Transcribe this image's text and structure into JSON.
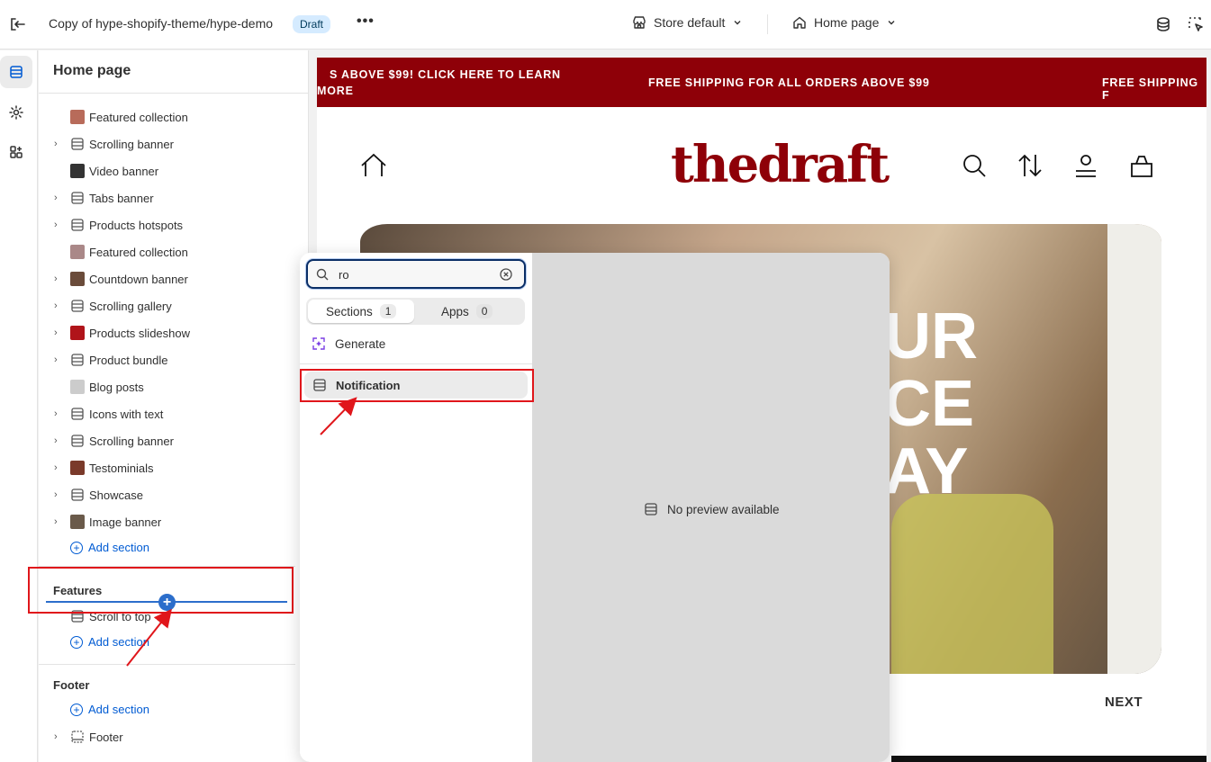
{
  "topbar": {
    "title": "Copy of hype-shopify-theme/hype-demo",
    "badge": "Draft",
    "more": "•••",
    "store": "Store default",
    "page": "Home page"
  },
  "sidebar": {
    "title": "Home page",
    "items": [
      {
        "label": "Featured collection",
        "expandable": false
      },
      {
        "label": "Scrolling banner",
        "expandable": true
      },
      {
        "label": "Video banner",
        "expandable": false
      },
      {
        "label": "Tabs banner",
        "expandable": true
      },
      {
        "label": "Products hotspots",
        "expandable": true
      },
      {
        "label": "Featured collection",
        "expandable": false
      },
      {
        "label": "Countdown banner",
        "expandable": true
      },
      {
        "label": "Scrolling gallery",
        "expandable": true
      },
      {
        "label": "Products slideshow",
        "expandable": true
      },
      {
        "label": "Product bundle",
        "expandable": true
      },
      {
        "label": "Blog posts",
        "expandable": false
      },
      {
        "label": "Icons with text",
        "expandable": true
      },
      {
        "label": "Scrolling banner",
        "expandable": true
      },
      {
        "label": "Testominials",
        "expandable": true
      },
      {
        "label": "Showcase",
        "expandable": true
      },
      {
        "label": "Image banner",
        "expandable": true
      }
    ],
    "add_section": "Add section",
    "features_title": "Features",
    "features_item": "Scroll to top",
    "footer_title": "Footer",
    "footer_item": "Footer"
  },
  "preview": {
    "announce_left_1": "S ABOVE $99! CLICK HERE TO LEARN",
    "announce_left_2": "MORE",
    "announce_mid": "FREE SHIPPING FOR ALL ORDERS ABOVE $99",
    "announce_right": "FREE SHIPPING F",
    "logo": "thedraft",
    "hero_line1": "UR",
    "hero_line2": "CE",
    "hero_line3": "AY",
    "next": "NEXT"
  },
  "popover": {
    "search_value": "ro",
    "tab_sections": "Sections",
    "tab_sections_count": "1",
    "tab_apps": "Apps",
    "tab_apps_count": "0",
    "generate": "Generate",
    "result": "Notification",
    "no_preview": "No preview available"
  },
  "colors": {
    "brand": "#8e0008",
    "accent": "#005bd3",
    "highlight": "#e0161b"
  }
}
